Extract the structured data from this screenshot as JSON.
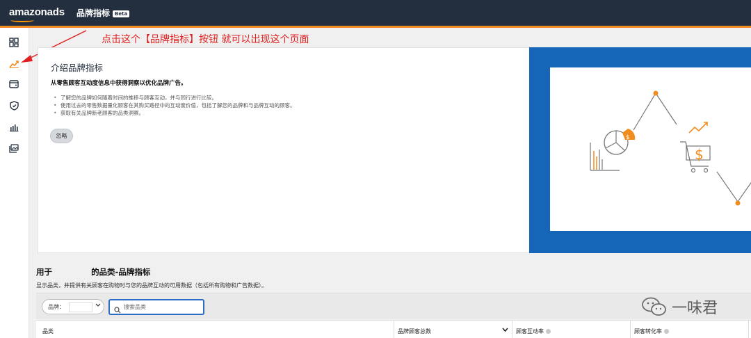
{
  "header": {
    "logo": "amazonads",
    "app_title": "品牌指标",
    "beta_badge": "Beta"
  },
  "sidebar": {
    "items": [
      {
        "icon": "dashboard-icon"
      },
      {
        "icon": "trend-chart-icon",
        "active": true
      },
      {
        "icon": "wallet-icon"
      },
      {
        "icon": "shield-icon"
      },
      {
        "icon": "bar-chart-icon"
      },
      {
        "icon": "media-library-icon"
      }
    ]
  },
  "annotation": {
    "text": "点击这个【品牌指标】按钮  就可以出现这个页面",
    "color": "#e02020"
  },
  "intro_card": {
    "title": "介绍品牌指标",
    "subtitle": "从零售顾客互动度信息中获得洞察以优化品牌广告。",
    "bullets": [
      "了解您的品牌如何随着时间的推移与顾客互动，并与同行进行比较。",
      "使用过去的零售数据量化顾客在其购买路径中的互动度价值，包括了解您的品牌和与品牌互动的顾客。",
      "获取有关品牌新老顾客的品类洞察。"
    ],
    "dismiss_label": "忽略"
  },
  "category_section": {
    "title_prefix": "用于",
    "title_suffix": "的品类-品牌指标",
    "description": "显示品类，并提供有关顾客在购物时与您的品牌互动的可用数据（包括所有购物和广告数据）。",
    "brand_filter_label": "品牌：",
    "brand_filter_value": "",
    "search_placeholder": "搜索品类",
    "search_value": ""
  },
  "table": {
    "columns": [
      {
        "label": "品类"
      },
      {
        "label": "品牌顾客总数",
        "sortable": true
      },
      {
        "label": "顾客互动率",
        "info": true
      },
      {
        "label": "顾客转化率",
        "info": true
      }
    ]
  },
  "watermark": {
    "text": "一味君"
  },
  "colors": {
    "topbar": "#232f3e",
    "accent": "#f08c1e",
    "hero_blue": "#1565b8",
    "link_blue": "#2b6cc4",
    "annotation_red": "#e02020"
  }
}
